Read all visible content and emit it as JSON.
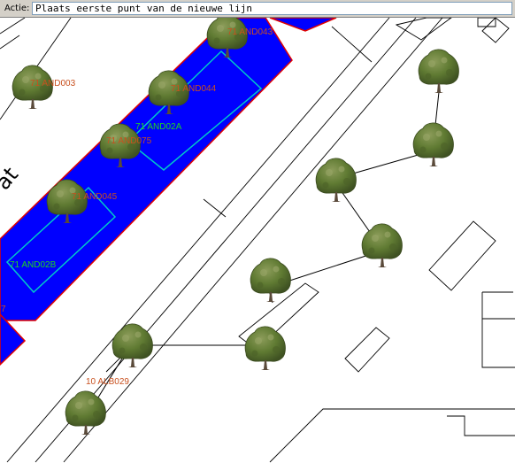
{
  "toolbar": {
    "label": "Actie:",
    "command_value": "Plaats eerste punt van de nieuwe lijn"
  },
  "map": {
    "street_name_fragment": "at",
    "labels": {
      "and043": "71 AND043",
      "and003": "71 AND003",
      "and044": "71 AND044",
      "and02a": "71 AND02A",
      "and075": "71 AND075",
      "and045": "71 AND045",
      "and02b": "71 AND02B",
      "alb029": "10 ALB029",
      "edge7": "7"
    },
    "colors": {
      "parcel_fill": "#0000ff",
      "parcel_border": "#ff0000",
      "label_orange": "#c8501e",
      "label_green": "#1fd61f",
      "inner_outline": "#00c8c8",
      "canopy": "#5f7a32",
      "trunk": "#5a4a3a"
    },
    "tree_icon": "tree-icon"
  }
}
